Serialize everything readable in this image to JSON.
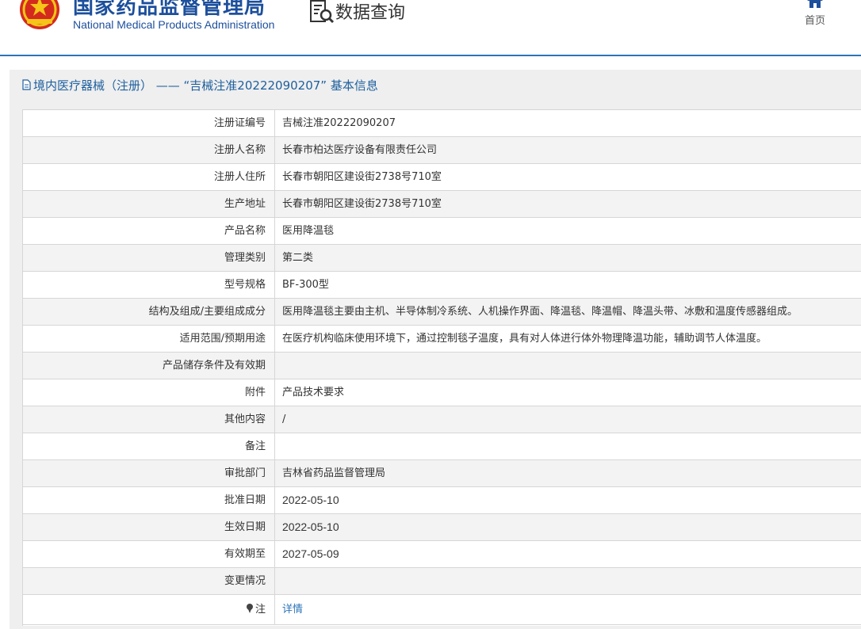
{
  "header": {
    "brand_cn": "国家药品监督管理局",
    "brand_en": "National Medical Products Administration",
    "query_title": "数据查询",
    "home_label": "首页",
    "accent_color": "#1d4f9c"
  },
  "panel": {
    "title": "境内医疗器械（注册） —— “吉械注准20222090207” 基本信息"
  },
  "rows": [
    {
      "label": "注册证编号",
      "value": "吉械注准20222090207"
    },
    {
      "label": "注册人名称",
      "value": "长春市柏达医疗设备有限责任公司"
    },
    {
      "label": "注册人住所",
      "value": "长春市朝阳区建设街2738号710室"
    },
    {
      "label": "生产地址",
      "value": "长春市朝阳区建设街2738号710室"
    },
    {
      "label": "产品名称",
      "value": "医用降温毯"
    },
    {
      "label": "管理类别",
      "value": "第二类"
    },
    {
      "label": "型号规格",
      "value": "BF-300型"
    },
    {
      "label": "结构及组成/主要组成成分",
      "value": "医用降温毯主要由主机、半导体制冷系统、人机操作界面、降温毯、降温帽、降温头带、冰敷和温度传感器组成。"
    },
    {
      "label": "适用范围/预期用途",
      "value": "在医疗机构临床使用环境下，通过控制毯子温度，具有对人体进行体外物理降温功能，辅助调节人体温度。"
    },
    {
      "label": "产品储存条件及有效期",
      "value": ""
    },
    {
      "label": "附件",
      "value": "产品技术要求"
    },
    {
      "label": "其他内容",
      "value": "/"
    },
    {
      "label": "备注",
      "value": ""
    },
    {
      "label": "审批部门",
      "value": "吉林省药品监督管理局"
    },
    {
      "label": "批准日期",
      "value": "2022-05-10"
    },
    {
      "label": "生效日期",
      "value": "2022-05-10"
    },
    {
      "label": "有效期至",
      "value": "2027-05-09"
    },
    {
      "label": "变更情况",
      "value": ""
    }
  ],
  "note_row": {
    "label": "注",
    "link_text": "详情"
  }
}
